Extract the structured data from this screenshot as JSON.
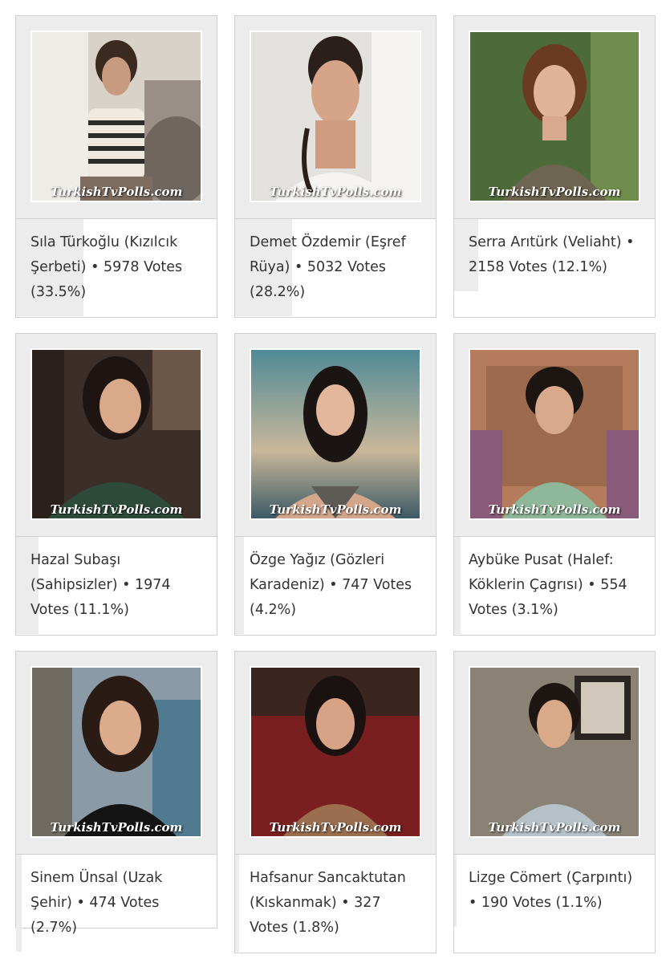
{
  "watermark": "TurkishTvPolls.com",
  "colors": {
    "card_border": "#cfcfcf",
    "photo_bg": "#ececec",
    "bar": "#ececec",
    "text": "#333333"
  },
  "entries": [
    {
      "name": "Sıla Türkoğlu",
      "show": "(Kızılcık Şerbeti)",
      "votes": "5978 Votes",
      "percent": "(33.5%)",
      "share": 0.335
    },
    {
      "name": "Demet Özdemir",
      "show": "(Eşref Rüya)",
      "votes": "5032 Votes",
      "percent": "(28.2%)",
      "share": 0.282
    },
    {
      "name": "Serra Arıtürk",
      "show": "(Veliaht)",
      "votes": "2158 Votes",
      "percent": "(12.1%)",
      "share": 0.121
    },
    {
      "name": "Hazal Subaşı",
      "show": "(Sahipsizler)",
      "votes": "1974 Votes",
      "percent": "(11.1%)",
      "share": 0.111
    },
    {
      "name": "Özge Yağız",
      "show": "(Gözleri Karadeniz)",
      "votes": "747 Votes",
      "percent": "(4.2%)",
      "share": 0.042
    },
    {
      "name": "Aybüke Pusat",
      "show": "(Halef: Köklerin Çagrısı)",
      "votes": "554 Votes",
      "percent": "(3.1%)",
      "share": 0.031
    },
    {
      "name": "Sinem Ünsal",
      "show": "(Uzak Şehir)",
      "votes": "474 Votes",
      "percent": "(2.7%)",
      "share": 0.027
    },
    {
      "name": "Hafsanur Sancaktutan",
      "show": "(Kıskanmak)",
      "votes": "327 Votes",
      "percent": "(1.8%)",
      "share": 0.018
    },
    {
      "name": "Lizge Cömert",
      "show": "(Çarpıntı)",
      "votes": "190 Votes",
      "percent": "(1.1%)",
      "share": 0.011
    }
  ]
}
